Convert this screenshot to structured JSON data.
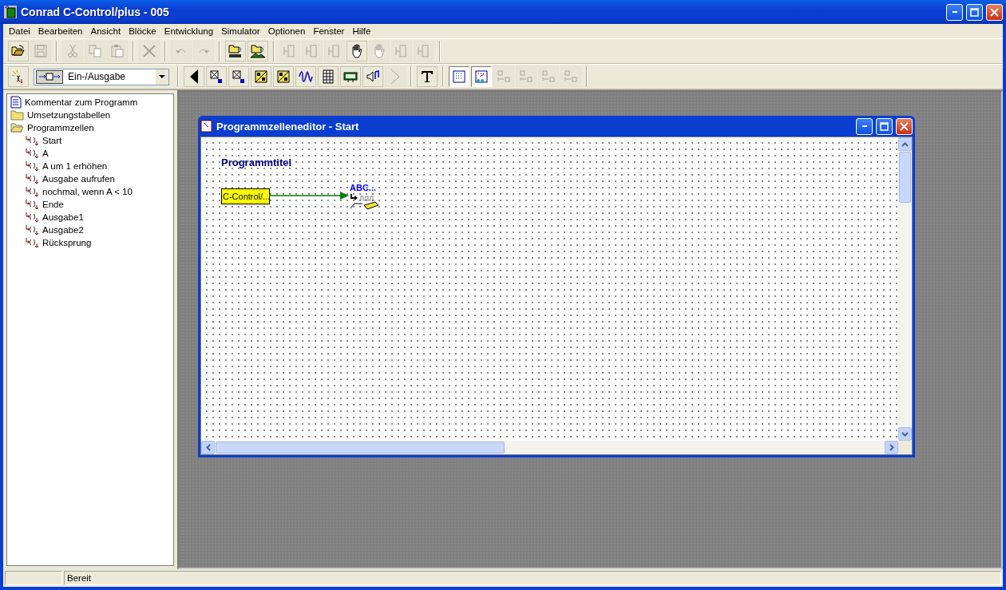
{
  "window": {
    "title": "Conrad C-Control/plus - 005"
  },
  "menu": [
    "Datei",
    "Bearbeiten",
    "Ansicht",
    "Blöcke",
    "Entwicklung",
    "Simulator",
    "Optionen",
    "Fenster",
    "Hilfe"
  ],
  "toolbar": [
    {
      "kind": "open",
      "disabled": false
    },
    {
      "kind": "save",
      "disabled": true
    },
    {
      "kind": "sep"
    },
    {
      "kind": "cut",
      "disabled": true
    },
    {
      "kind": "copy",
      "disabled": true
    },
    {
      "kind": "paste",
      "disabled": true
    },
    {
      "kind": "sep"
    },
    {
      "kind": "delete",
      "disabled": true
    },
    {
      "kind": "sep"
    },
    {
      "kind": "undo",
      "disabled": true
    },
    {
      "kind": "redo",
      "disabled": true
    },
    {
      "kind": "sep"
    },
    {
      "kind": "compile",
      "disabled": false
    },
    {
      "kind": "load",
      "disabled": false
    },
    {
      "kind": "sep"
    },
    {
      "kind": "align",
      "disabled": true
    },
    {
      "kind": "align",
      "disabled": true
    },
    {
      "kind": "align",
      "disabled": true
    },
    {
      "kind": "hand",
      "disabled": false
    },
    {
      "kind": "hand",
      "disabled": true
    },
    {
      "kind": "align",
      "disabled": true
    },
    {
      "kind": "align",
      "disabled": true
    },
    {
      "kind": "sep"
    }
  ],
  "block_palette": {
    "category": "Ein-/Ausgabe"
  },
  "palette": [
    {
      "kind": "wand",
      "disabled": false,
      "pressed": false
    },
    {
      "kind": "combo"
    },
    {
      "kind": "sep"
    },
    {
      "kind": "left",
      "disabled": false,
      "pressed": false
    },
    {
      "kind": "port8",
      "disabled": false,
      "pressed": false
    },
    {
      "kind": "port16",
      "disabled": false,
      "pressed": false
    },
    {
      "kind": "ad",
      "disabled": false,
      "pressed": false
    },
    {
      "kind": "da",
      "disabled": false,
      "pressed": false
    },
    {
      "kind": "wave",
      "disabled": false,
      "pressed": false
    },
    {
      "kind": "keypad",
      "disabled": false,
      "pressed": false
    },
    {
      "kind": "display",
      "disabled": false,
      "pressed": false
    },
    {
      "kind": "speaker",
      "disabled": false,
      "pressed": false
    },
    {
      "kind": "right",
      "disabled": true,
      "pressed": false
    },
    {
      "kind": "sep"
    },
    {
      "kind": "text",
      "disabled": false,
      "pressed": false
    },
    {
      "kind": "sep"
    },
    {
      "kind": "grid",
      "disabled": false,
      "pressed": true
    },
    {
      "kind": "snap",
      "disabled": false,
      "pressed": true
    },
    {
      "kind": "arrange",
      "disabled": true,
      "pressed": false
    },
    {
      "kind": "arrange",
      "disabled": true,
      "pressed": false
    },
    {
      "kind": "arrange",
      "disabled": true,
      "pressed": false
    },
    {
      "kind": "arrange",
      "disabled": true,
      "pressed": false
    },
    {
      "kind": "sep"
    }
  ],
  "tree": [
    {
      "kind": "document",
      "label": "Kommentar zum Programm"
    },
    {
      "kind": "folder",
      "label": "Umsetzungstabellen",
      "expanded": false
    },
    {
      "kind": "folder",
      "label": "Programmzellen",
      "expanded": true,
      "children": [
        {
          "kind": "cell",
          "label": "Start"
        },
        {
          "kind": "cell",
          "label": "A"
        },
        {
          "kind": "cell",
          "label": "A um 1 erhöhen"
        },
        {
          "kind": "cell",
          "label": "Ausgabe aufrufen"
        },
        {
          "kind": "cell",
          "label": "nochmal, wenn A < 10"
        },
        {
          "kind": "cell",
          "label": "Ende"
        },
        {
          "kind": "cell",
          "label": "Ausgabe1"
        },
        {
          "kind": "cell",
          "label": "Ausgabe2"
        },
        {
          "kind": "cell",
          "label": "Rücksprung"
        }
      ]
    }
  ],
  "editor": {
    "title": "Programmzelleneditor - Start",
    "program_title": "Programmtitel",
    "block": "C-Control/...",
    "output_label": "ABC..."
  },
  "status_bar": {
    "text": "Bereit"
  }
}
